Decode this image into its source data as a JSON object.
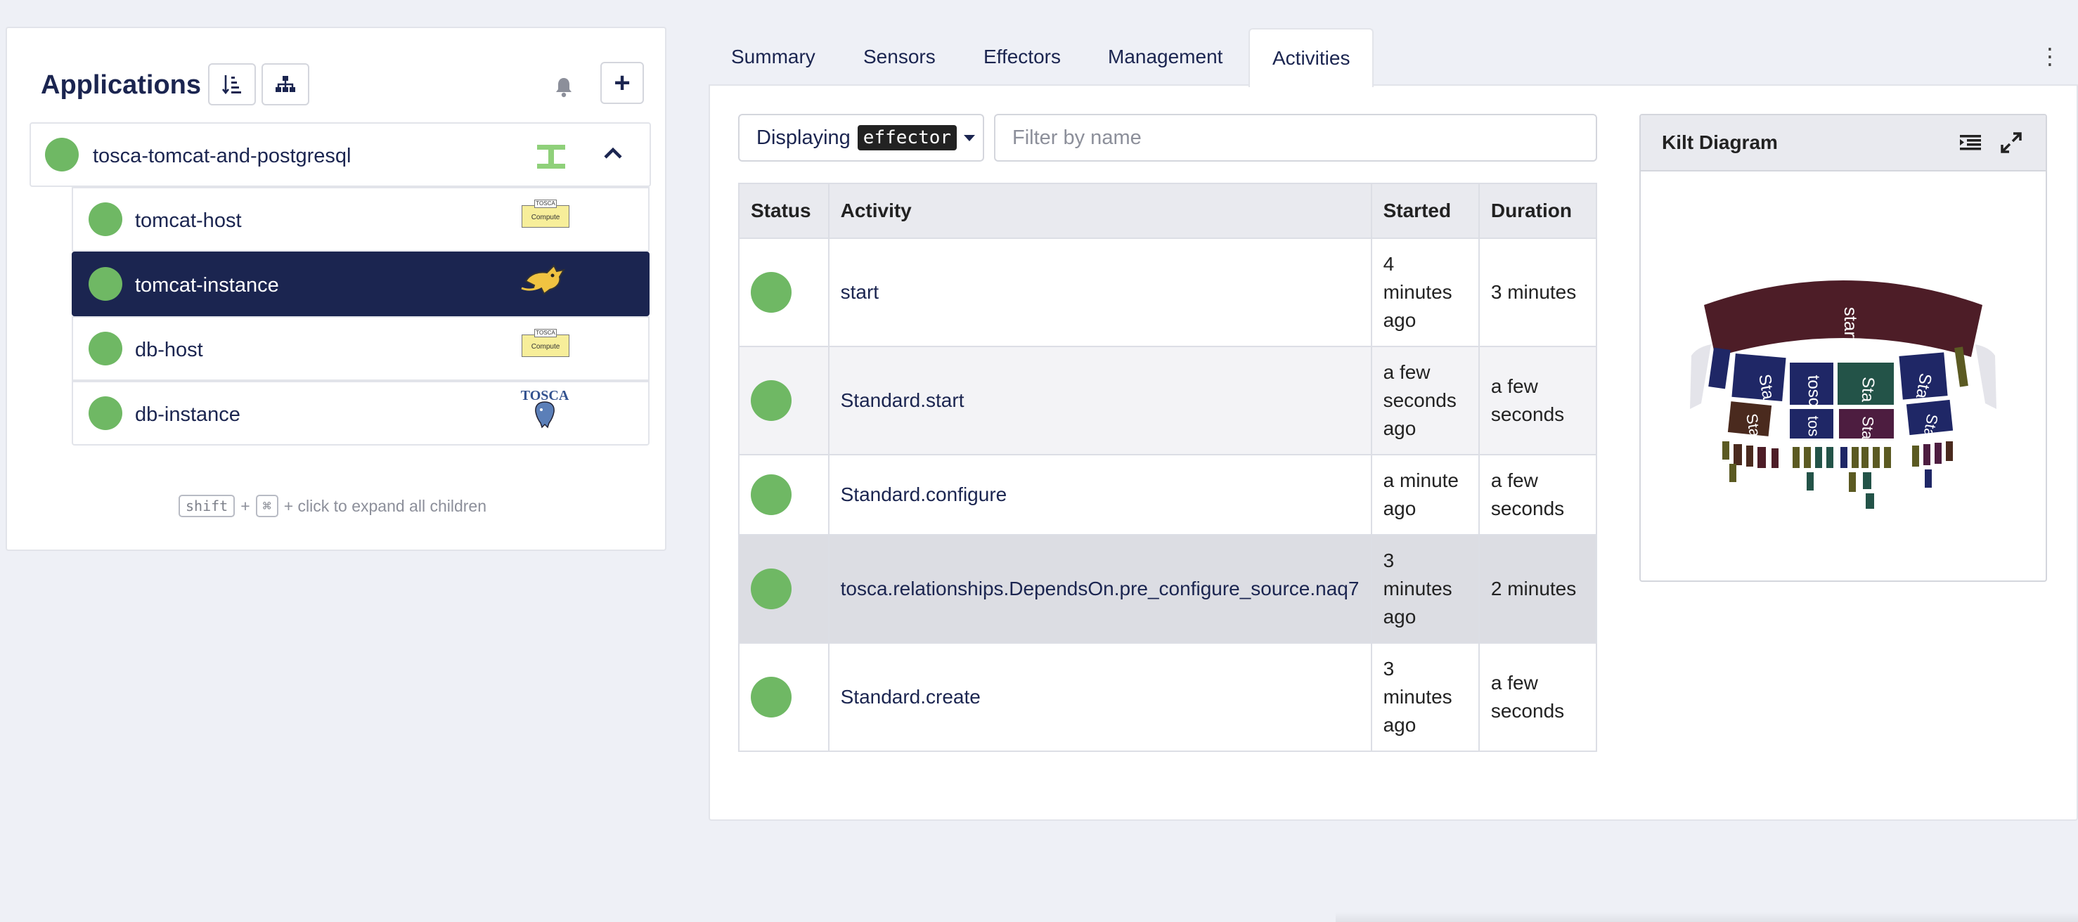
{
  "sidebar": {
    "title": "Applications",
    "sort_icon": "sort-icon",
    "tree_icon": "tree-icon",
    "bell_icon": "bell-icon",
    "add_label": "+",
    "root": {
      "name": "tosca-tomcat-and-postgresql",
      "status": "running",
      "icon": "tosca-topology-icon"
    },
    "children": [
      {
        "name": "tomcat-host",
        "icon": "tosca-compute-icon",
        "selected": false
      },
      {
        "name": "tomcat-instance",
        "icon": "tomcat-icon",
        "selected": true
      },
      {
        "name": "db-host",
        "icon": "tosca-compute-icon",
        "selected": false
      },
      {
        "name": "db-instance",
        "icon": "tosca-postgres-icon",
        "selected": false
      }
    ],
    "compute_label_top": "TOSCA",
    "compute_label_bottom": "Compute",
    "postgres_label": "TOSCA",
    "hint": {
      "key1": "shift",
      "plus": "+",
      "key2": "⌘",
      "text": "+ click to expand all children"
    }
  },
  "tabs": [
    "Summary",
    "Sensors",
    "Effectors",
    "Management",
    "Activities"
  ],
  "active_tab": "Activities",
  "activities": {
    "displaying_label": "Displaying",
    "displaying_value": "effector",
    "filter_placeholder": "Filter by name",
    "columns": [
      "Status",
      "Activity",
      "Started",
      "Duration"
    ],
    "rows": [
      {
        "activity": "start",
        "started": "4 minutes ago",
        "duration": "3 minutes"
      },
      {
        "activity": "Standard.start",
        "started": "a few seconds ago",
        "duration": "a few seconds"
      },
      {
        "activity": "Standard.configure",
        "started": "a minute ago",
        "duration": "a few seconds"
      },
      {
        "activity": "tosca.relationships.DependsOn.pre_configure_source.naq7",
        "started": "3 minutes ago",
        "duration": "2 minutes"
      },
      {
        "activity": "Standard.create",
        "started": "3 minutes ago",
        "duration": "a few seconds"
      }
    ]
  },
  "kilt": {
    "title": "Kilt Diagram",
    "list_icon": "list-indent-icon",
    "expand_icon": "expand-icon",
    "top_label": "start",
    "mid_labels": [
      "Sta",
      "tosc",
      "Sta",
      "Sta"
    ],
    "low_labels": [
      "Sta",
      "tos",
      "Sta",
      "Sta"
    ]
  },
  "colors": {
    "navy": "#1b2550",
    "green": "#6fb864",
    "kilt_maroon": "#4d1d27"
  }
}
